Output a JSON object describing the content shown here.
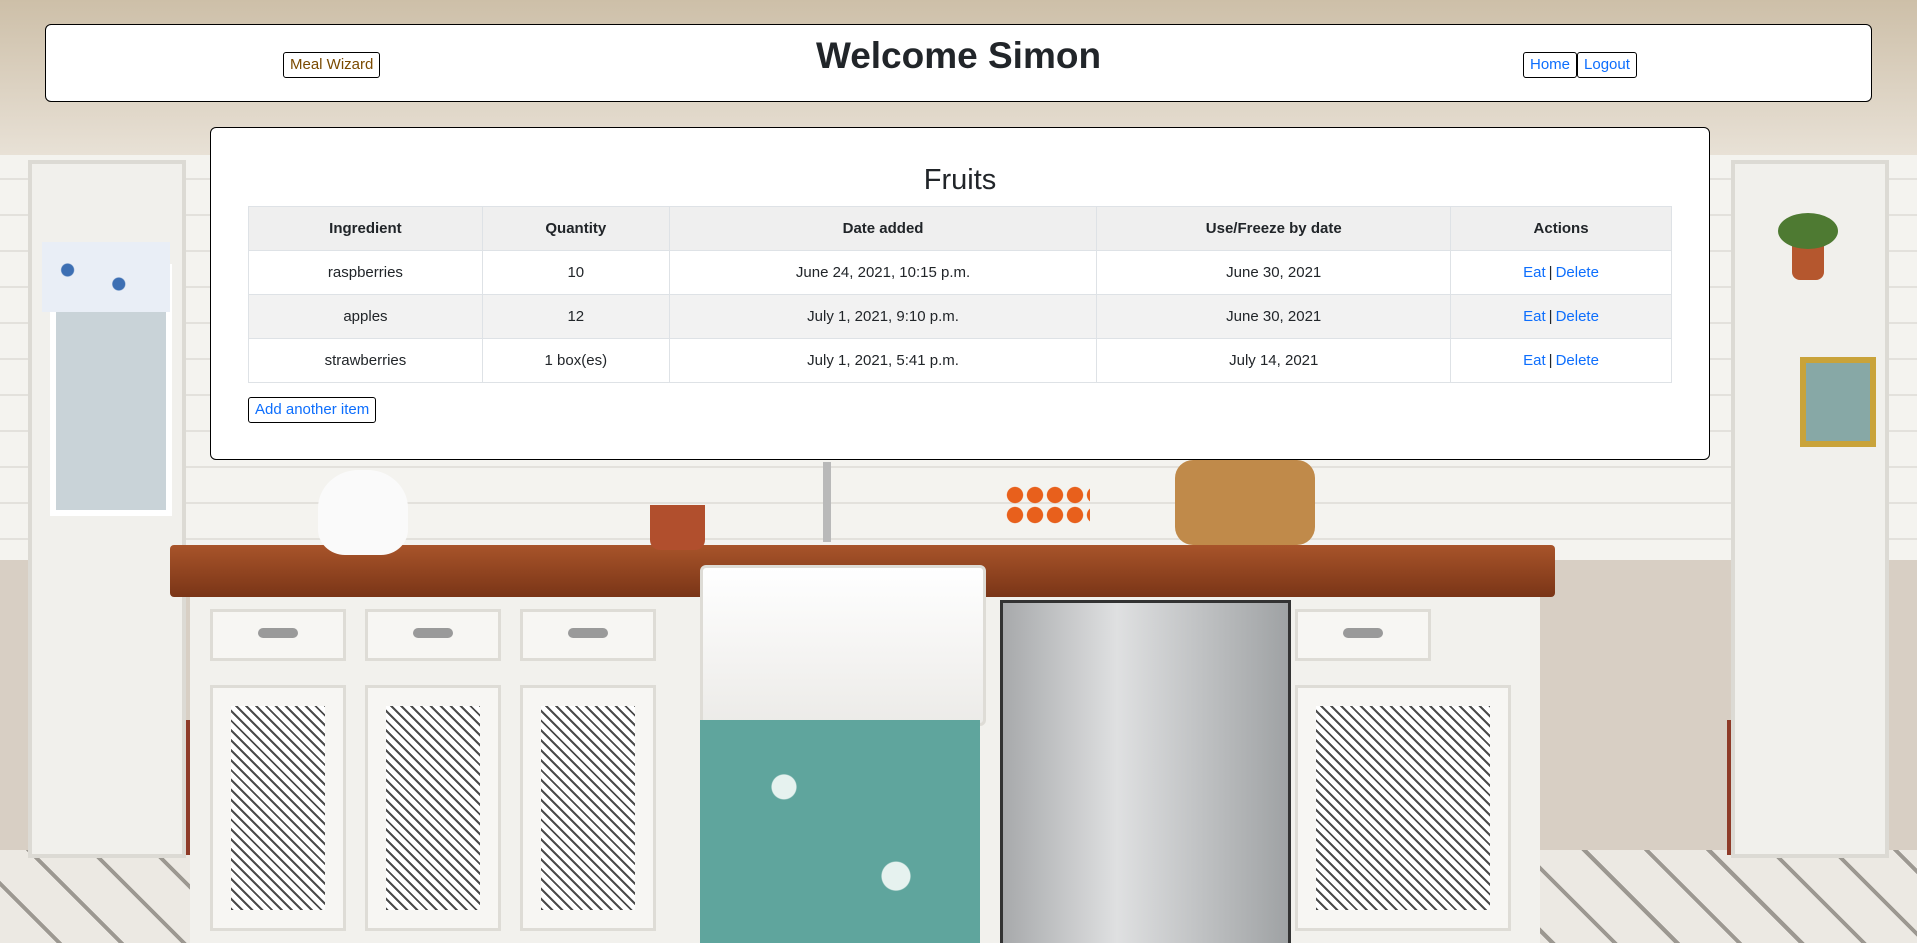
{
  "header": {
    "wizard_label": "Meal Wizard",
    "title": "Welcome Simon",
    "home_label": "Home",
    "logout_label": "Logout"
  },
  "main": {
    "section_title": "Fruits",
    "columns": [
      "Ingredient",
      "Quantity",
      "Date added",
      "Use/Freeze by date",
      "Actions"
    ],
    "rows": [
      {
        "ingredient": "raspberries",
        "quantity": "10",
        "date_added": "June 24, 2021, 10:15 p.m.",
        "use_by": "June 30, 2021",
        "eat": "Eat",
        "sep": "|",
        "delete": "Delete"
      },
      {
        "ingredient": "apples",
        "quantity": "12",
        "date_added": "July 1, 2021, 9:10 p.m.",
        "use_by": "June 30, 2021",
        "eat": "Eat",
        "sep": "|",
        "delete": "Delete"
      },
      {
        "ingredient": "strawberries",
        "quantity": "1 box(es)",
        "date_added": "July 1, 2021, 5:41 p.m.",
        "use_by": "July 14, 2021",
        "eat": "Eat",
        "sep": "|",
        "delete": "Delete"
      }
    ],
    "add_label": "Add another item"
  },
  "colors": {
    "link": "#0d6efd",
    "wizard_text": "#7a4a00",
    "header_bg": "#ffffff"
  }
}
